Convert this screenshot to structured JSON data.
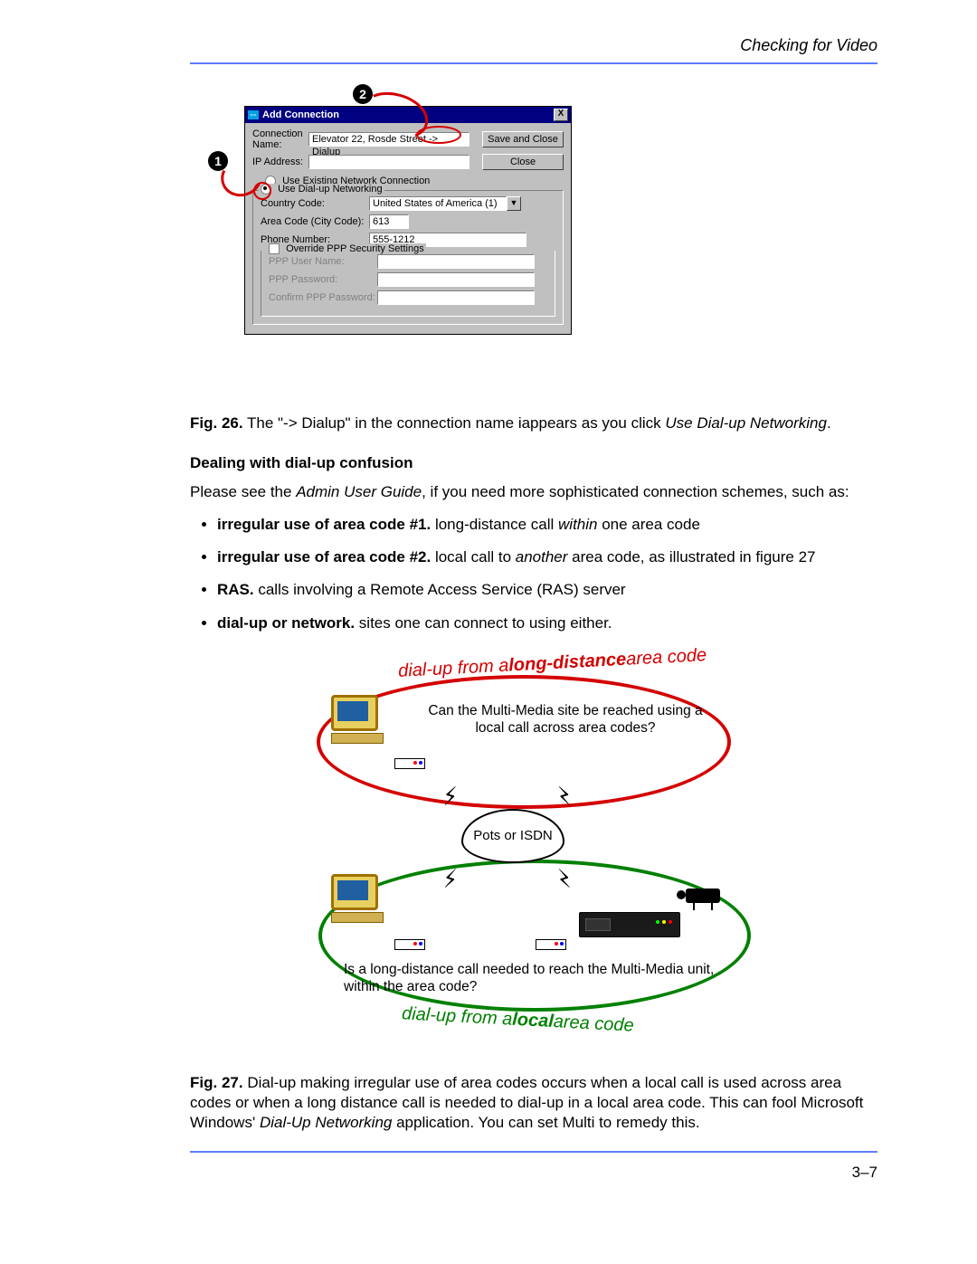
{
  "header": {
    "running_head": "Checking for Video"
  },
  "fig26": {
    "callout1": "1",
    "callout2": "2",
    "titlebar": {
      "title": "Add Connection",
      "close": "X"
    },
    "labels": {
      "conn_name": "Connection Name:",
      "ip": "IP Address:",
      "radio_existing": "Use Existing Network Connection",
      "radio_dun": "Use Dial-up Networking",
      "country": "Country Code:",
      "area": "Area Code (City Code):",
      "phone": "Phone Number:",
      "check_ppp": "Override PPP Security Settings",
      "ppp_user": "PPP User Name:",
      "ppp_pass": "PPP Password:",
      "ppp_conf": "Confirm PPP Password:"
    },
    "values": {
      "conn_name": "Elevator 22, Rosde Street -> Dialup",
      "country": "United States of America (1)",
      "area": "613",
      "phone": "555-1212"
    },
    "buttons": {
      "save": "Save and Close",
      "close": "Close"
    },
    "caption_prefix": "Fig. 26.",
    "caption_body": "The \"-> Dialup\" in the connection name iappears as you click ",
    "caption_ital": "Use Dial-up Networking",
    "caption_tail": "."
  },
  "section": {
    "heading": "Dealing with dial-up confusion",
    "intro_a": "Please see the ",
    "intro_ital": "Admin User Guide",
    "intro_b": ", if you need more sophisticated connection schemes, such as:",
    "bullets": [
      {
        "bold": "irregular use of area code #1.",
        "plain": " long-distance call ",
        "ital": "within",
        "tail": " one area code"
      },
      {
        "bold": "irregular use of area code #2.",
        "plain": " local call to ",
        "ital": "another",
        "tail": " area code, as illustrated in figure 27"
      },
      {
        "bold": "RAS.",
        "plain": " calls involving a Remote Access Service (RAS) server",
        "ital": "",
        "tail": ""
      },
      {
        "bold": "dial-up or network.",
        "plain": " sites one can connect to using either.",
        "ital": "",
        "tail": ""
      }
    ]
  },
  "fig27": {
    "arc_red_a": "dial-up from a ",
    "arc_red_b": "long-distance",
    "arc_red_c": " area code",
    "arc_green_a": "dial-up from a ",
    "arc_green_b": "local",
    "arc_green_c": " area code",
    "q1": "Can the Multi-Media site be reached using a local call across area codes?",
    "cloud": "Pots or ISDN",
    "q2": "Is a long-distance call needed to reach the Multi-Media unit, within the area code?",
    "caption_prefix": "Fig. 27.",
    "caption_body": "Dial-up making irregular use of area codes occurs when a local call is used across area codes or when a long distance call is needed to dial-up in a local area code. This can fool Microsoft Windows' ",
    "caption_ital": "Dial-Up Networking",
    "caption_tail": " application. You can set Multi to remedy this."
  },
  "footer": {
    "page_num": "3–7"
  }
}
